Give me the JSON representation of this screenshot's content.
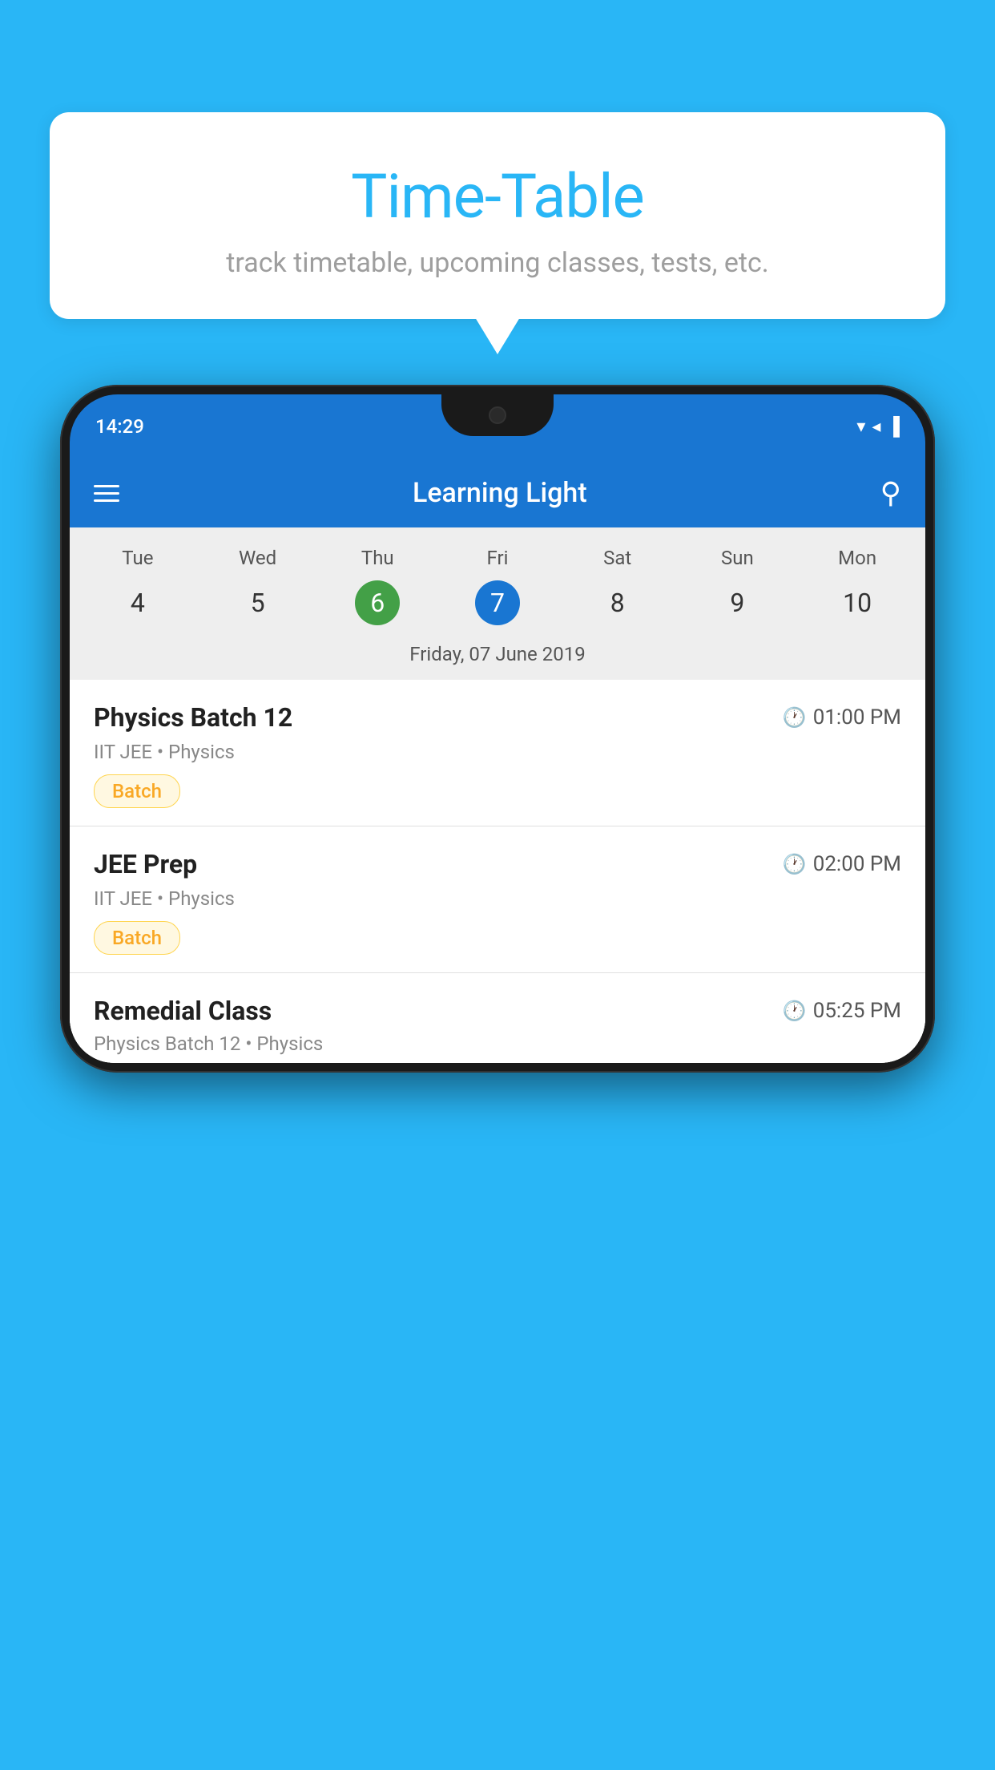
{
  "background_color": "#29B6F6",
  "bubble": {
    "title": "Time-Table",
    "subtitle": "track timetable, upcoming classes, tests, etc."
  },
  "status_bar": {
    "time": "14:29",
    "wifi": "▼",
    "signal": "▲",
    "battery": "▓"
  },
  "app_header": {
    "title": "Learning Light"
  },
  "calendar": {
    "days_of_week": [
      "Tue",
      "Wed",
      "Thu",
      "Fri",
      "Sat",
      "Sun",
      "Mon"
    ],
    "dates": [
      "4",
      "5",
      "6",
      "7",
      "8",
      "9",
      "10"
    ],
    "today_index": 2,
    "selected_index": 3,
    "selected_label": "Friday, 07 June 2019"
  },
  "classes": [
    {
      "name": "Physics Batch 12",
      "time": "01:00 PM",
      "meta": "IIT JEE • Physics",
      "badge": "Batch"
    },
    {
      "name": "JEE Prep",
      "time": "02:00 PM",
      "meta": "IIT JEE • Physics",
      "badge": "Batch"
    },
    {
      "name": "Remedial Class",
      "time": "05:25 PM",
      "meta": "Physics Batch 12 • Physics",
      "badge": null
    }
  ]
}
